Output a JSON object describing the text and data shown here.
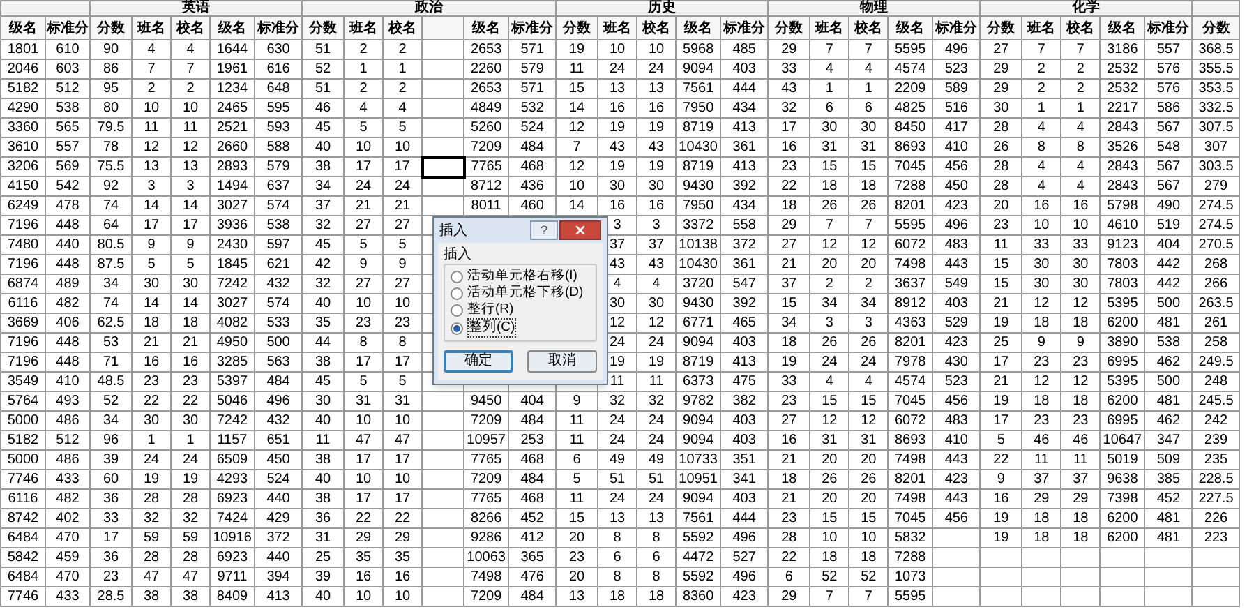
{
  "groups": [
    {
      "columns": [
        "级名",
        "标准分"
      ]
    },
    {
      "title": "英语",
      "columns": [
        "分数",
        "班名",
        "校名",
        "级名",
        "标准分"
      ]
    },
    {
      "title": "政治",
      "columns": [
        "分数",
        "班名",
        "校名",
        null,
        "级名",
        "标准分"
      ]
    },
    {
      "title": "历史",
      "columns": [
        "分数",
        "班名",
        "校名",
        "级名",
        "标准分"
      ]
    },
    {
      "title": "物理",
      "columns": [
        "分数",
        "班名",
        "校名",
        "级名",
        "标准分"
      ]
    },
    {
      "title": "化学",
      "columns": [
        "分数",
        "班名",
        "校名",
        "级名",
        "标准分"
      ]
    },
    {
      "columns": [
        "分数"
      ]
    }
  ],
  "rows": [
    {
      "has_active_cell": false,
      "cells": [
        "1801",
        "610",
        "90",
        "4",
        "4",
        "1644",
        "630",
        "51",
        "2",
        "2",
        null,
        "2653",
        "571",
        "19",
        "10",
        "10",
        "5968",
        "485",
        "29",
        "7",
        "7",
        "5595",
        "496",
        "27",
        "7",
        "7",
        "3186",
        "557",
        "368.5"
      ]
    },
    {
      "has_active_cell": false,
      "cells": [
        "2046",
        "603",
        "86",
        "7",
        "7",
        "1961",
        "616",
        "52",
        "1",
        "1",
        null,
        "2260",
        "579",
        "11",
        "24",
        "24",
        "9094",
        "403",
        "33",
        "4",
        "4",
        "4574",
        "523",
        "29",
        "2",
        "2",
        "2532",
        "576",
        "355.5"
      ]
    },
    {
      "has_active_cell": false,
      "cells": [
        "5182",
        "512",
        "95",
        "2",
        "2",
        "1234",
        "648",
        "51",
        "2",
        "2",
        null,
        "2653",
        "571",
        "15",
        "13",
        "13",
        "7561",
        "444",
        "43",
        "1",
        "1",
        "2209",
        "589",
        "29",
        "2",
        "2",
        "2532",
        "576",
        "353.5"
      ]
    },
    {
      "has_active_cell": false,
      "cells": [
        "4290",
        "538",
        "80",
        "10",
        "10",
        "2465",
        "595",
        "46",
        "4",
        "4",
        null,
        "4849",
        "532",
        "14",
        "16",
        "16",
        "7950",
        "434",
        "32",
        "6",
        "6",
        "4825",
        "516",
        "30",
        "1",
        "1",
        "2217",
        "586",
        "332.5"
      ]
    },
    {
      "has_active_cell": false,
      "cells": [
        "3360",
        "565",
        "79.5",
        "11",
        "11",
        "2521",
        "593",
        "45",
        "5",
        "5",
        null,
        "5260",
        "524",
        "12",
        "19",
        "19",
        "8719",
        "413",
        "17",
        "30",
        "30",
        "8450",
        "417",
        "28",
        "4",
        "4",
        "2843",
        "567",
        "307.5"
      ]
    },
    {
      "has_active_cell": false,
      "cells": [
        "3610",
        "557",
        "78",
        "12",
        "12",
        "2660",
        "588",
        "40",
        "10",
        "10",
        null,
        "7209",
        "484",
        "7",
        "43",
        "43",
        "10430",
        "361",
        "16",
        "31",
        "31",
        "8693",
        "410",
        "26",
        "8",
        "8",
        "3526",
        "548",
        "307"
      ]
    },
    {
      "has_active_cell": true,
      "cells": [
        "3206",
        "569",
        "75.5",
        "13",
        "13",
        "2893",
        "579",
        "38",
        "17",
        "17",
        null,
        "7765",
        "468",
        "12",
        "19",
        "19",
        "8719",
        "413",
        "23",
        "15",
        "15",
        "7045",
        "456",
        "28",
        "4",
        "4",
        "2843",
        "567",
        "303.5"
      ]
    },
    {
      "has_active_cell": false,
      "cells": [
        "4150",
        "542",
        "92",
        "3",
        "3",
        "1494",
        "637",
        "34",
        "24",
        "24",
        null,
        "8712",
        "436",
        "10",
        "30",
        "30",
        "9430",
        "392",
        "22",
        "18",
        "18",
        "7288",
        "450",
        "28",
        "4",
        "4",
        "2843",
        "567",
        "279"
      ]
    },
    {
      "has_active_cell": false,
      "cells": [
        "6249",
        "478",
        "74",
        "14",
        "14",
        "3027",
        "574",
        "37",
        "21",
        "21",
        null,
        "8011",
        "460",
        "14",
        "16",
        "16",
        "7950",
        "434",
        "18",
        "26",
        "26",
        "8201",
        "423",
        "20",
        "16",
        "16",
        "5798",
        "490",
        "274.5"
      ]
    },
    {
      "has_active_cell": false,
      "cells": [
        "7196",
        "448",
        "64",
        "17",
        "17",
        "3936",
        "538",
        "32",
        "27",
        "27",
        null,
        null,
        null,
        null,
        "3",
        "3",
        "3372",
        "558",
        "29",
        "7",
        "7",
        "5595",
        "496",
        "23",
        "10",
        "10",
        "4610",
        "519",
        "274.5"
      ]
    },
    {
      "has_active_cell": false,
      "cells": [
        "7480",
        "440",
        "80.5",
        "9",
        "9",
        "2430",
        "597",
        "45",
        "5",
        "5",
        null,
        null,
        null,
        null,
        "37",
        "37",
        "10138",
        "372",
        "27",
        "12",
        "12",
        "6072",
        "483",
        "11",
        "33",
        "33",
        "9123",
        "404",
        "270.5"
      ]
    },
    {
      "has_active_cell": false,
      "cells": [
        "7196",
        "448",
        "87.5",
        "5",
        "5",
        "1845",
        "621",
        "42",
        "9",
        "9",
        null,
        null,
        null,
        null,
        "43",
        "43",
        "10430",
        "361",
        "21",
        "20",
        "20",
        "7498",
        "443",
        "15",
        "30",
        "30",
        "7803",
        "442",
        "268"
      ]
    },
    {
      "has_active_cell": false,
      "cells": [
        "6874",
        "489",
        "34",
        "30",
        "30",
        "7242",
        "432",
        "32",
        "27",
        "27",
        null,
        null,
        null,
        null,
        "4",
        "4",
        "3720",
        "547",
        "37",
        "2",
        "2",
        "3637",
        "549",
        "15",
        "30",
        "30",
        "7803",
        "442",
        "266"
      ]
    },
    {
      "has_active_cell": false,
      "cells": [
        "6116",
        "482",
        "74",
        "14",
        "14",
        "3027",
        "574",
        "40",
        "10",
        "10",
        null,
        null,
        null,
        null,
        "30",
        "30",
        "9430",
        "392",
        "15",
        "34",
        "34",
        "8912",
        "403",
        "21",
        "12",
        "12",
        "5395",
        "500",
        "263.5"
      ]
    },
    {
      "has_active_cell": false,
      "cells": [
        "3669",
        "406",
        "62.5",
        "18",
        "18",
        "4082",
        "533",
        "35",
        "23",
        "23",
        null,
        null,
        null,
        null,
        "12",
        "12",
        "6771",
        "465",
        "34",
        "3",
        "3",
        "4363",
        "529",
        "19",
        "18",
        "18",
        "6200",
        "481",
        "261"
      ]
    },
    {
      "has_active_cell": false,
      "cells": [
        "7196",
        "448",
        "53",
        "21",
        "21",
        "4950",
        "500",
        "44",
        "8",
        "8",
        null,
        null,
        null,
        null,
        "24",
        "24",
        "9094",
        "403",
        "18",
        "26",
        "26",
        "8201",
        "423",
        "25",
        "9",
        "9",
        "3890",
        "538",
        "258"
      ]
    },
    {
      "has_active_cell": false,
      "cells": [
        "7196",
        "448",
        "71",
        "16",
        "16",
        "3285",
        "563",
        "38",
        "17",
        "17",
        null,
        null,
        null,
        null,
        "19",
        "19",
        "8719",
        "413",
        "19",
        "24",
        "24",
        "7978",
        "430",
        "17",
        "23",
        "23",
        "6995",
        "462",
        "249.5"
      ]
    },
    {
      "has_active_cell": false,
      "cells": [
        "3549",
        "410",
        "48.5",
        "23",
        "23",
        "5397",
        "484",
        "45",
        "5",
        "5",
        null,
        null,
        null,
        null,
        "11",
        "11",
        "6373",
        "475",
        "33",
        "4",
        "4",
        "4574",
        "523",
        "21",
        "12",
        "12",
        "5395",
        "500",
        "248"
      ]
    },
    {
      "has_active_cell": false,
      "cells": [
        "5764",
        "493",
        "52",
        "22",
        "22",
        "5046",
        "496",
        "30",
        "31",
        "31",
        null,
        "9450",
        "404",
        "9",
        "32",
        "32",
        "9782",
        "382",
        "23",
        "15",
        "15",
        "7045",
        "456",
        "19",
        "18",
        "18",
        "6200",
        "481",
        "245.5"
      ]
    },
    {
      "has_active_cell": false,
      "cells": [
        "5000",
        "486",
        "34",
        "30",
        "30",
        "7242",
        "432",
        "40",
        "10",
        "10",
        null,
        "7209",
        "484",
        "11",
        "24",
        "24",
        "9094",
        "403",
        "27",
        "12",
        "12",
        "6072",
        "483",
        "17",
        "23",
        "23",
        "6995",
        "462",
        "242"
      ]
    },
    {
      "has_active_cell": false,
      "cells": [
        "5182",
        "512",
        "96",
        "1",
        "1",
        "1157",
        "651",
        "11",
        "47",
        "47",
        null,
        "10957",
        "253",
        "11",
        "24",
        "24",
        "9094",
        "403",
        "16",
        "31",
        "31",
        "8693",
        "410",
        "5",
        "46",
        "46",
        "10647",
        "347",
        "239"
      ]
    },
    {
      "has_active_cell": false,
      "cells": [
        "5000",
        "486",
        "39",
        "24",
        "24",
        "6509",
        "450",
        "38",
        "17",
        "17",
        null,
        "7765",
        "468",
        "6",
        "49",
        "49",
        "10733",
        "351",
        "21",
        "20",
        "20",
        "7498",
        "443",
        "22",
        "11",
        "11",
        "5019",
        "509",
        "235"
      ]
    },
    {
      "has_active_cell": false,
      "cells": [
        "7746",
        "433",
        "60",
        "19",
        "19",
        "4293",
        "524",
        "40",
        "10",
        "10",
        null,
        "7209",
        "484",
        "5",
        "51",
        "51",
        "10951",
        "341",
        "18",
        "26",
        "26",
        "8201",
        "423",
        "9",
        "37",
        "37",
        "9638",
        "385",
        "228.5"
      ]
    },
    {
      "has_active_cell": false,
      "cells": [
        "6116",
        "482",
        "36",
        "28",
        "28",
        "6923",
        "440",
        "38",
        "17",
        "17",
        null,
        "7765",
        "468",
        "11",
        "24",
        "24",
        "9094",
        "403",
        "21",
        "20",
        "20",
        "7498",
        "443",
        "16",
        "29",
        "29",
        "7398",
        "452",
        "227.5"
      ]
    },
    {
      "has_active_cell": false,
      "cells": [
        "8742",
        "402",
        "33",
        "32",
        "32",
        "7424",
        "429",
        "36",
        "22",
        "22",
        null,
        "8266",
        "452",
        "15",
        "13",
        "13",
        "7561",
        "444",
        "23",
        "15",
        "15",
        "7045",
        "456",
        "19",
        "18",
        "18",
        "6200",
        "481",
        "226"
      ]
    },
    {
      "has_active_cell": false,
      "cells": [
        "6484",
        "470",
        "17",
        "59",
        "59",
        "10916",
        "372",
        "31",
        "29",
        "29",
        null,
        "9286",
        "412",
        "20",
        "8",
        "8",
        "5592",
        "496",
        "28",
        "10",
        "10",
        "5832",
        null,
        "19",
        "18",
        "18",
        "6200",
        "481",
        "223"
      ]
    },
    {
      "has_active_cell": false,
      "cells": [
        "5842",
        "459",
        "36",
        "28",
        "28",
        "6923",
        "440",
        "25",
        "35",
        "35",
        null,
        "10063",
        "365",
        "23",
        "6",
        "6",
        "4472",
        "527",
        "22",
        "18",
        "18",
        "7288",
        null,
        null,
        null,
        null,
        null,
        null,
        null
      ]
    },
    {
      "has_active_cell": false,
      "cells": [
        "6484",
        "470",
        "23",
        "47",
        "47",
        "9711",
        "394",
        "39",
        "16",
        "16",
        null,
        "7498",
        "476",
        "20",
        "8",
        "8",
        "5592",
        "496",
        "6",
        "52",
        "52",
        "1073",
        null,
        null,
        null,
        null,
        null,
        null,
        null
      ]
    },
    {
      "has_active_cell": false,
      "cells": [
        "7746",
        "433",
        "28.5",
        "38",
        "38",
        "8409",
        "413",
        "40",
        "10",
        "10",
        null,
        "7209",
        "484",
        "13",
        "18",
        "18",
        "8360",
        "423",
        "29",
        "7",
        "7",
        "5595",
        null,
        null,
        null,
        null,
        null,
        null,
        null
      ]
    }
  ],
  "dialog": {
    "title": "插入",
    "help_button": "?",
    "group_label": "插入",
    "options": [
      {
        "label": "活动单元格右移(I)",
        "selected": false
      },
      {
        "label": "活动单元格下移(D)",
        "selected": false
      },
      {
        "label": "整行(R)",
        "selected": false
      },
      {
        "label": "整列(C)",
        "selected": true
      }
    ],
    "buttons": [
      {
        "label": "确定",
        "focused": true
      },
      {
        "label": "取消",
        "focused": false
      }
    ]
  }
}
